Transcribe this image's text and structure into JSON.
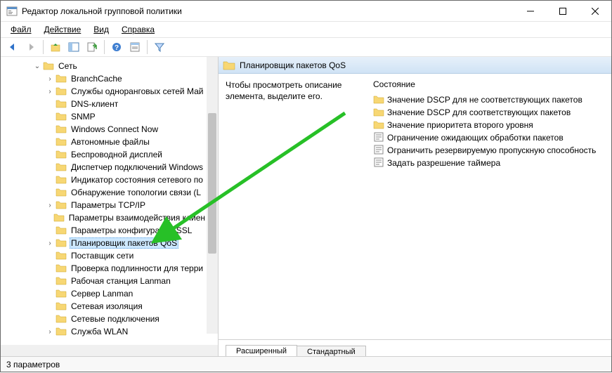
{
  "window": {
    "title": "Редактор локальной групповой политики"
  },
  "menus": {
    "file": "Файл",
    "action": "Действие",
    "view": "Вид",
    "help": "Справка"
  },
  "tree": {
    "root": {
      "label": "Сеть",
      "expanded": true
    },
    "items": [
      {
        "label": "BranchCache",
        "hasChildren": true
      },
      {
        "label": "Службы одноранговых сетей Май",
        "hasChildren": true
      },
      {
        "label": "DNS-клиент",
        "hasChildren": false
      },
      {
        "label": "SNMP",
        "hasChildren": false
      },
      {
        "label": "Windows Connect Now",
        "hasChildren": false
      },
      {
        "label": "Автономные файлы",
        "hasChildren": false
      },
      {
        "label": "Беспроводной дисплей",
        "hasChildren": false
      },
      {
        "label": "Диспетчер подключений Windows",
        "hasChildren": false
      },
      {
        "label": "Индикатор состояния сетевого по",
        "hasChildren": false
      },
      {
        "label": "Обнаружение топологии связи (L",
        "hasChildren": false
      },
      {
        "label": "Параметры TCP/IP",
        "hasChildren": true
      },
      {
        "label": "Параметры взаимодействия клиен",
        "hasChildren": false
      },
      {
        "label": "Параметры конфигурации SSL",
        "hasChildren": false
      },
      {
        "label": "Планировщик пакетов QoS",
        "hasChildren": true,
        "selected": true
      },
      {
        "label": "Поставщик сети",
        "hasChildren": false
      },
      {
        "label": "Проверка подлинности для терри",
        "hasChildren": false
      },
      {
        "label": "Рабочая станция Lanman",
        "hasChildren": false
      },
      {
        "label": "Сервер Lanman",
        "hasChildren": false
      },
      {
        "label": "Сетевая изоляция",
        "hasChildren": false
      },
      {
        "label": "Сетевые подключения",
        "hasChildren": false
      },
      {
        "label": "Служба WLAN",
        "hasChildren": true
      }
    ]
  },
  "content": {
    "header": "Планировщик пакетов QoS",
    "description": "Чтобы просмотреть описание элемента, выделите его.",
    "state_heading": "Состояние",
    "items": [
      {
        "label": "Значение DSCP для не соответствующих пакетов",
        "type": "folder"
      },
      {
        "label": "Значение DSCP для соответствующих пакетов",
        "type": "folder"
      },
      {
        "label": "Значение приоритета второго уровня",
        "type": "folder"
      },
      {
        "label": "Ограничение ожидающих обработки пакетов",
        "type": "setting"
      },
      {
        "label": "Ограничить резервируемую пропускную способность",
        "type": "setting"
      },
      {
        "label": "Задать разрешение таймера",
        "type": "setting"
      }
    ]
  },
  "tabs": {
    "extended": "Расширенный",
    "standard": "Стандартный"
  },
  "status": "3 параметров"
}
